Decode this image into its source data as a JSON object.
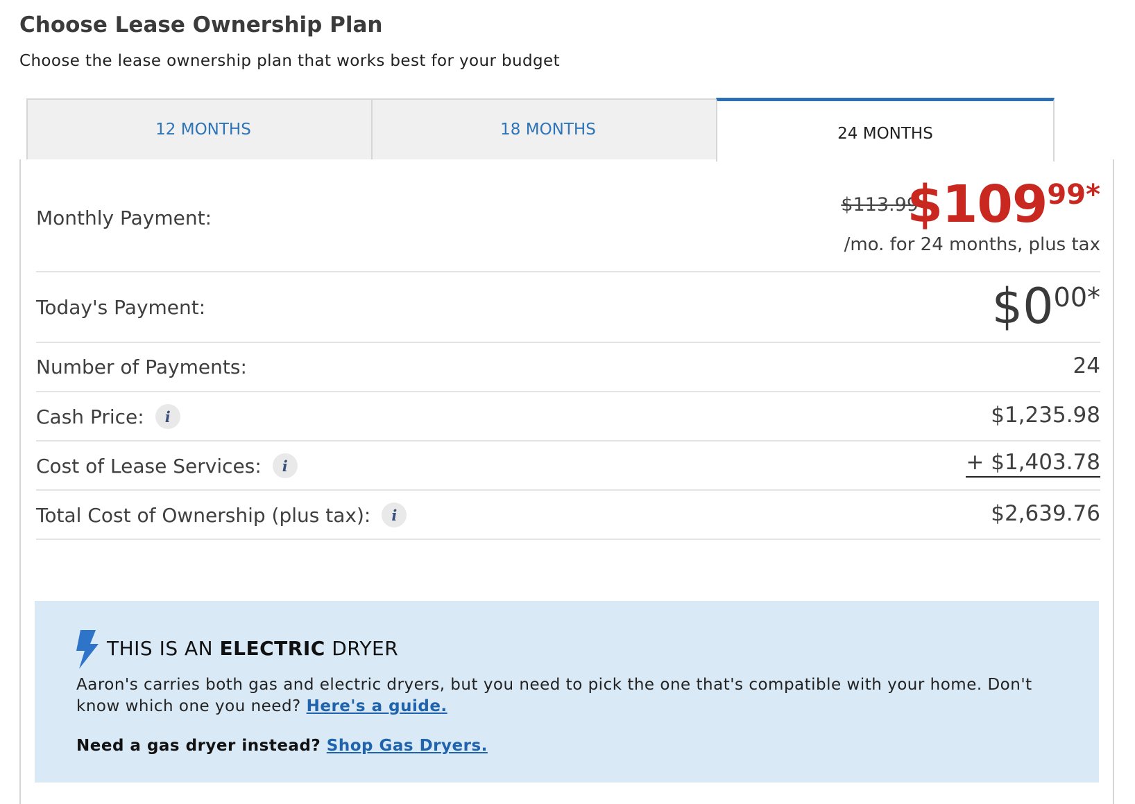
{
  "header": {
    "title": "Choose Lease Ownership Plan",
    "subtitle": "Choose the lease ownership plan that works best for your budget"
  },
  "tabs": [
    {
      "label": "12 MONTHS",
      "active": false
    },
    {
      "label": "18 MONTHS",
      "active": false
    },
    {
      "label": "24 MONTHS",
      "active": true
    }
  ],
  "plan": {
    "monthly": {
      "label": "Monthly Payment:",
      "old_price": "$113.99",
      "price_dollars": "$109",
      "price_cents": "99*",
      "note": "/mo. for 24 months, plus tax"
    },
    "today": {
      "label": "Today's Payment:",
      "price_dollars": "$0",
      "price_cents": "00*"
    },
    "payments": {
      "label": "Number of Payments:",
      "value": "24"
    },
    "cash": {
      "label": "Cash Price:",
      "value": "$1,235.98"
    },
    "lease_cost": {
      "label": "Cost of Lease Services:",
      "value": "+ $1,403.78"
    },
    "total": {
      "label": "Total Cost of Ownership (plus tax):",
      "value": "$2,639.76"
    }
  },
  "notice": {
    "heading_pre": "THIS IS AN ",
    "heading_bold": "ELECTRIC",
    "heading_post": " DRYER",
    "body": "Aaron's carries both gas and electric dryers, but you need to pick the one that's compatible with your home. Don't know which one you need? ",
    "guide_link": "Here's a guide.",
    "foot": "Need a gas dryer instead? ",
    "shop_link": "Shop Gas Dryers."
  },
  "colors": {
    "accent": "#2e6fb4",
    "price_red": "#c8281f",
    "notice_bg": "#d9e9f6",
    "link": "#1f63ad"
  }
}
